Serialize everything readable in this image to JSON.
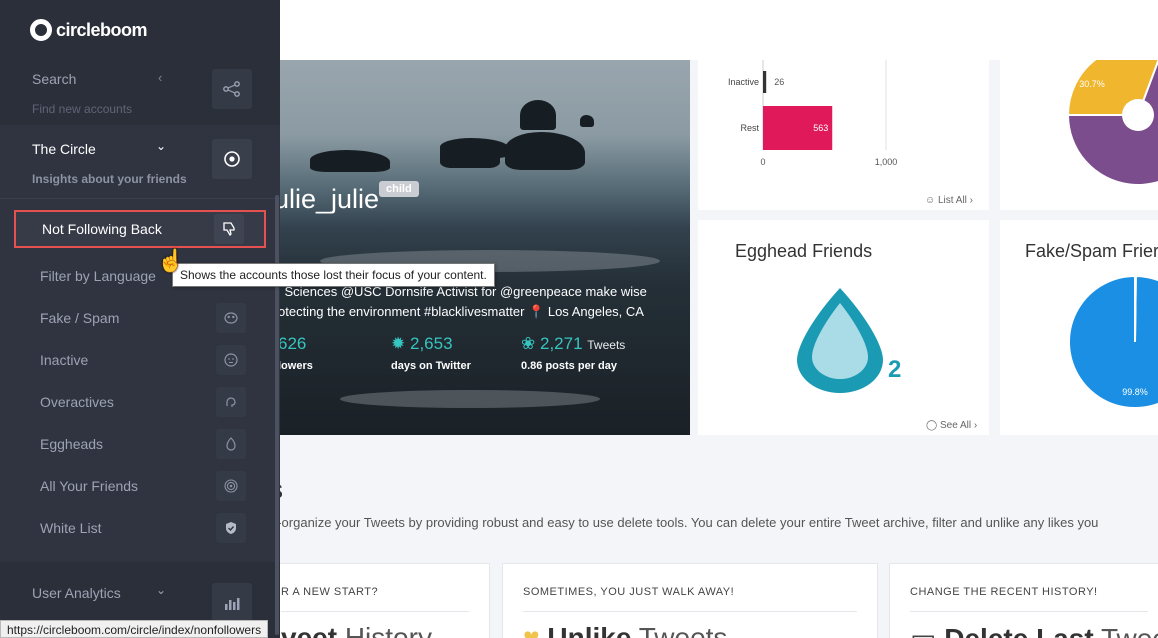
{
  "brand": {
    "name": "circleboom"
  },
  "sidebar": {
    "search": {
      "label": "Search",
      "sub": "Find new accounts",
      "icon": "network-icon"
    },
    "circle": {
      "label": "The Circle",
      "sub": "Insights about your friends",
      "icon": "target-icon"
    },
    "items": [
      {
        "label": "Not Following Back",
        "icon": "thumbs-down-icon",
        "active": true
      },
      {
        "label": "Filter by Language",
        "icon": ""
      },
      {
        "label": "Fake / Spam",
        "icon": "mask-icon"
      },
      {
        "label": "Inactive",
        "icon": "sleepy-face-icon"
      },
      {
        "label": "Overactives",
        "icon": "brain-icon"
      },
      {
        "label": "Eggheads",
        "icon": "egg-icon"
      },
      {
        "label": "All Your Friends",
        "icon": "rings-icon"
      },
      {
        "label": "White List",
        "icon": "shield-check-icon"
      }
    ],
    "user_analytics": {
      "label": "User Analytics",
      "icon": "bar-chart-icon"
    }
  },
  "tooltip": "Shows the accounts those lost their focus of your content.",
  "status_url": "https://circleboom.com/circle/index/nonfollowers",
  "profile": {
    "name": "ulie_julie",
    "badge": "child",
    "bio_line1": "l Sciences @USC Dornsife Activist for @greenpeace make wise",
    "bio_line2": "otecting the environment #blacklivesmatter",
    "location": "Los Angeles, CA",
    "followers_value": "626",
    "followers_label": "lowers",
    "days_value": "2,653",
    "days_label": "days on Twitter",
    "tweets_value": "2,271",
    "tweets_unit": "Tweets",
    "tweets_label": "0.86 posts per day"
  },
  "activity_card": {
    "link": "List All",
    "chart_data": {
      "type": "bar",
      "orientation": "horizontal",
      "categories": [
        "Inactive",
        "Rest"
      ],
      "values": [
        26,
        563
      ],
      "tick_labels": [
        "0",
        "1,000"
      ],
      "xlim": [
        0,
        1000
      ],
      "colors": [
        "#333333",
        "#e0195a"
      ]
    }
  },
  "pie_top": {
    "chart_data": {
      "type": "pie",
      "slices": [
        {
          "label": "30.7%",
          "value": 30.7,
          "color": "#f0b62d"
        },
        {
          "label": "",
          "value": 69.3,
          "color": "#7b4d8c"
        }
      ]
    }
  },
  "egghead_card": {
    "title": "Egghead Friends",
    "count": "2",
    "link": "See All"
  },
  "fake_card": {
    "title": "Fake/Spam Frier",
    "chart_data": {
      "type": "pie",
      "slices": [
        {
          "label": "99.8%",
          "value": 99.8,
          "color": "#1a8fe3"
        },
        {
          "label": "",
          "value": 0.2,
          "color": "#ffffff"
        }
      ]
    }
  },
  "section": {
    "title": "s",
    "desc": "e-organize your Tweets by providing robust and easy to use delete tools. You can delete your entire Tweet archive, filter and unlike any likes you"
  },
  "bottom_cards": [
    {
      "caption": "R A NEW START?",
      "bold": "veet",
      "light": "History"
    },
    {
      "caption": "SOMETIMES, YOU JUST WALK AWAY!",
      "bold": "Unlike",
      "light": "Tweets"
    },
    {
      "caption": "CHANGE THE RECENT HISTORY!",
      "bold": "Delete Last",
      "light": "Tweets"
    }
  ]
}
